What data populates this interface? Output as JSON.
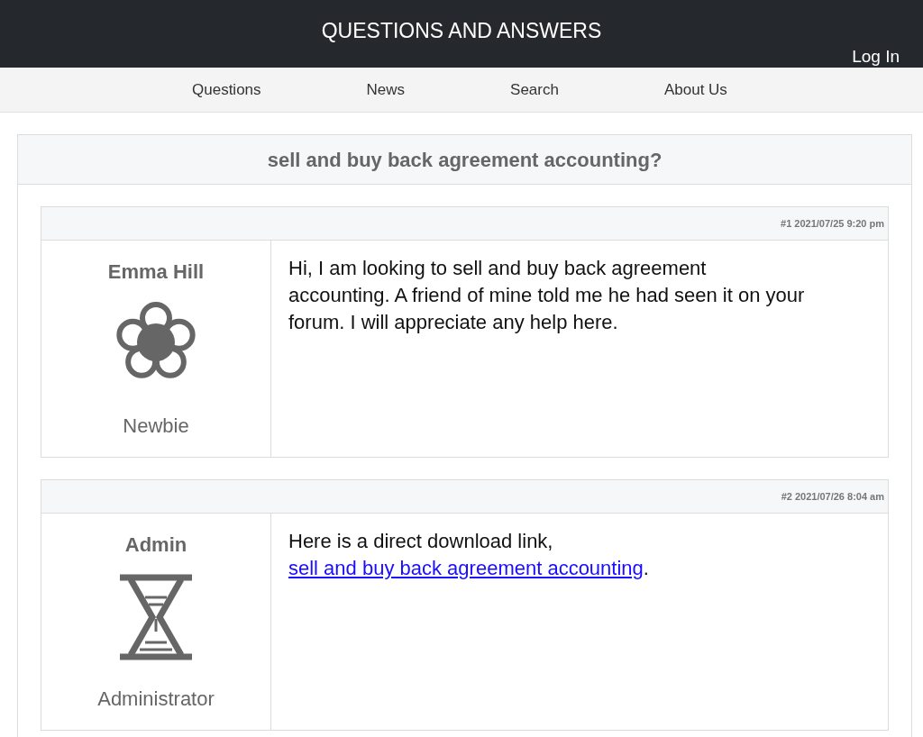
{
  "header": {
    "title": "QUESTIONS AND ANSWERS",
    "login": "Log In"
  },
  "nav": [
    "Questions",
    "News",
    "Search",
    "About Us"
  ],
  "thread": {
    "title": "sell and buy back agreement accounting?",
    "posts": [
      {
        "meta": "#1 2021/07/25 9:20 pm",
        "author": "Emma Hill",
        "kind": "flower",
        "rank": "Newbie",
        "body": "Hi, I am looking to sell and buy back agreement accounting. A friend of mine told me he had seen it on your forum. I will appreciate any help here."
      },
      {
        "meta": "#2 2021/07/26 8:04 am",
        "author": "Admin",
        "kind": "hourglass",
        "rank": "Administrator",
        "body": "Here is a direct download link, ",
        "link": "sell and buy back agreement accounting",
        "after": "."
      }
    ]
  }
}
